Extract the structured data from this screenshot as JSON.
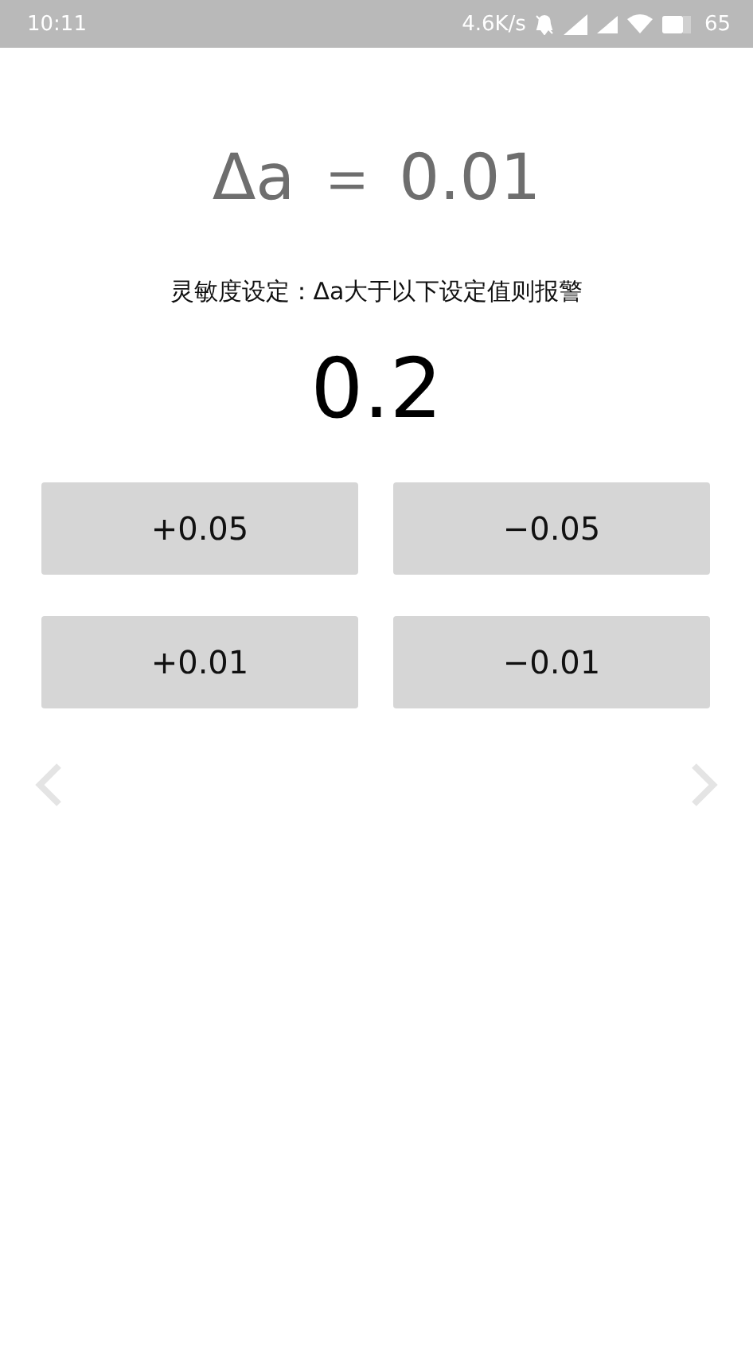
{
  "status_bar": {
    "time": "10:11",
    "network_speed": "4.6K/s",
    "battery": "65"
  },
  "delta_display": "Δa ＝ 0.01",
  "sensitivity_label": "灵敏度设定：Δa大于以下设定值则报警",
  "threshold_value": "0.2",
  "buttons": [
    {
      "label": "+0.05"
    },
    {
      "label": "−0.05"
    },
    {
      "label": "+0.01"
    },
    {
      "label": "−0.01"
    }
  ]
}
